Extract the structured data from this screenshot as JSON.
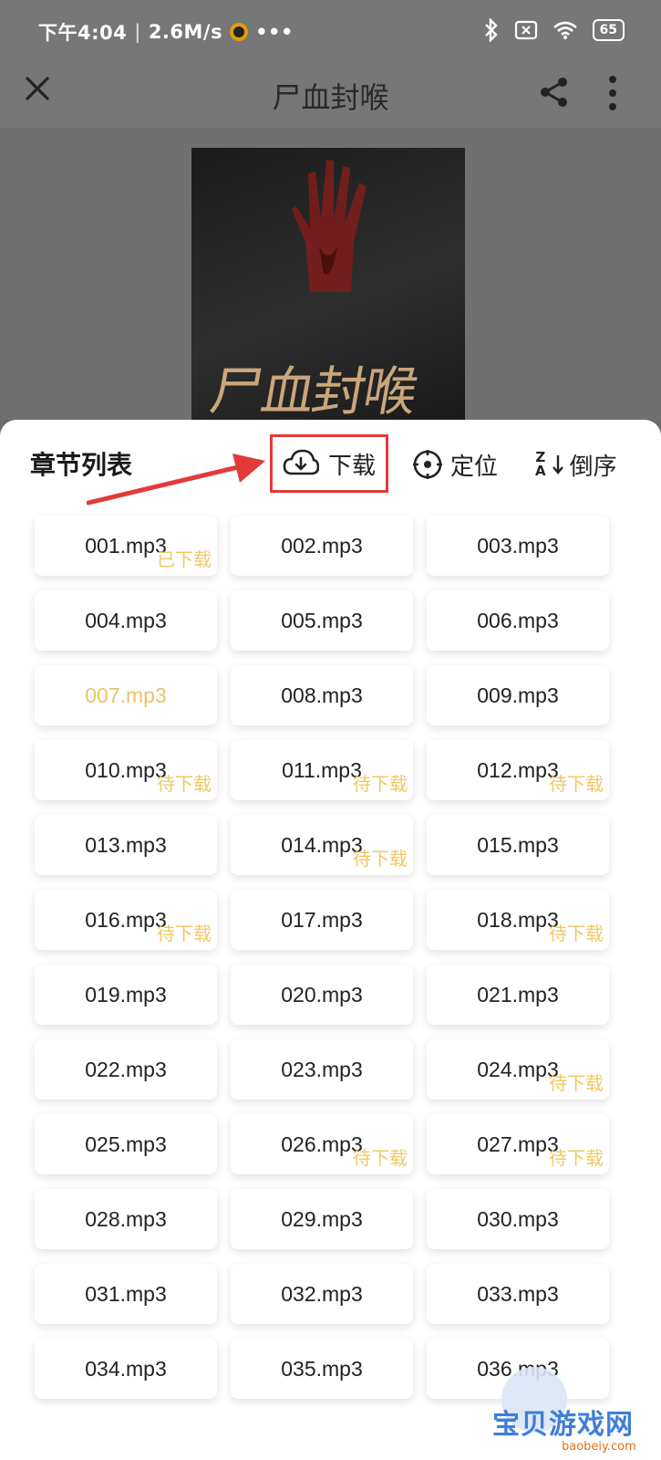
{
  "status_bar": {
    "time": "下午4:04",
    "speed": "2.6M/s",
    "dots": "•••",
    "battery": "65"
  },
  "header": {
    "title": "尸血封喉"
  },
  "cover": {
    "title": "尸血封喉"
  },
  "toolbar": {
    "list_title": "章节列表",
    "download_label": "下载",
    "locate_label": "定位",
    "reverse_label": "倒序",
    "reverse_top": "Z",
    "reverse_bottom": "A"
  },
  "chapters": [
    {
      "name": "001.mp3",
      "badge": "已下载"
    },
    {
      "name": "002.mp3",
      "badge": ""
    },
    {
      "name": "003.mp3",
      "badge": ""
    },
    {
      "name": "004.mp3",
      "badge": ""
    },
    {
      "name": "005.mp3",
      "badge": ""
    },
    {
      "name": "006.mp3",
      "badge": ""
    },
    {
      "name": "007.mp3",
      "badge": "",
      "active": true
    },
    {
      "name": "008.mp3",
      "badge": ""
    },
    {
      "name": "009.mp3",
      "badge": ""
    },
    {
      "name": "010.mp3",
      "badge": "待下载"
    },
    {
      "name": "011.mp3",
      "badge": "待下载"
    },
    {
      "name": "012.mp3",
      "badge": "待下载"
    },
    {
      "name": "013.mp3",
      "badge": ""
    },
    {
      "name": "014.mp3",
      "badge": "待下载"
    },
    {
      "name": "015.mp3",
      "badge": ""
    },
    {
      "name": "016.mp3",
      "badge": "待下载"
    },
    {
      "name": "017.mp3",
      "badge": ""
    },
    {
      "name": "018.mp3",
      "badge": "待下载"
    },
    {
      "name": "019.mp3",
      "badge": ""
    },
    {
      "name": "020.mp3",
      "badge": ""
    },
    {
      "name": "021.mp3",
      "badge": ""
    },
    {
      "name": "022.mp3",
      "badge": ""
    },
    {
      "name": "023.mp3",
      "badge": ""
    },
    {
      "name": "024.mp3",
      "badge": "待下载"
    },
    {
      "name": "025.mp3",
      "badge": ""
    },
    {
      "name": "026.mp3",
      "badge": "待下载"
    },
    {
      "name": "027.mp3",
      "badge": "待下载"
    },
    {
      "name": "028.mp3",
      "badge": ""
    },
    {
      "name": "029.mp3",
      "badge": ""
    },
    {
      "name": "030.mp3",
      "badge": ""
    },
    {
      "name": "031.mp3",
      "badge": ""
    },
    {
      "name": "032.mp3",
      "badge": ""
    },
    {
      "name": "033.mp3",
      "badge": ""
    },
    {
      "name": "034.mp3",
      "badge": ""
    },
    {
      "name": "035.mp3",
      "badge": ""
    },
    {
      "name": "036.mp3",
      "badge": ""
    }
  ],
  "watermark": {
    "text": "宝贝游戏网",
    "sub": "baobeiy.com"
  },
  "colors": {
    "accent": "#f1c865",
    "highlight_box": "#e33a3a",
    "overlay": "#777777"
  }
}
